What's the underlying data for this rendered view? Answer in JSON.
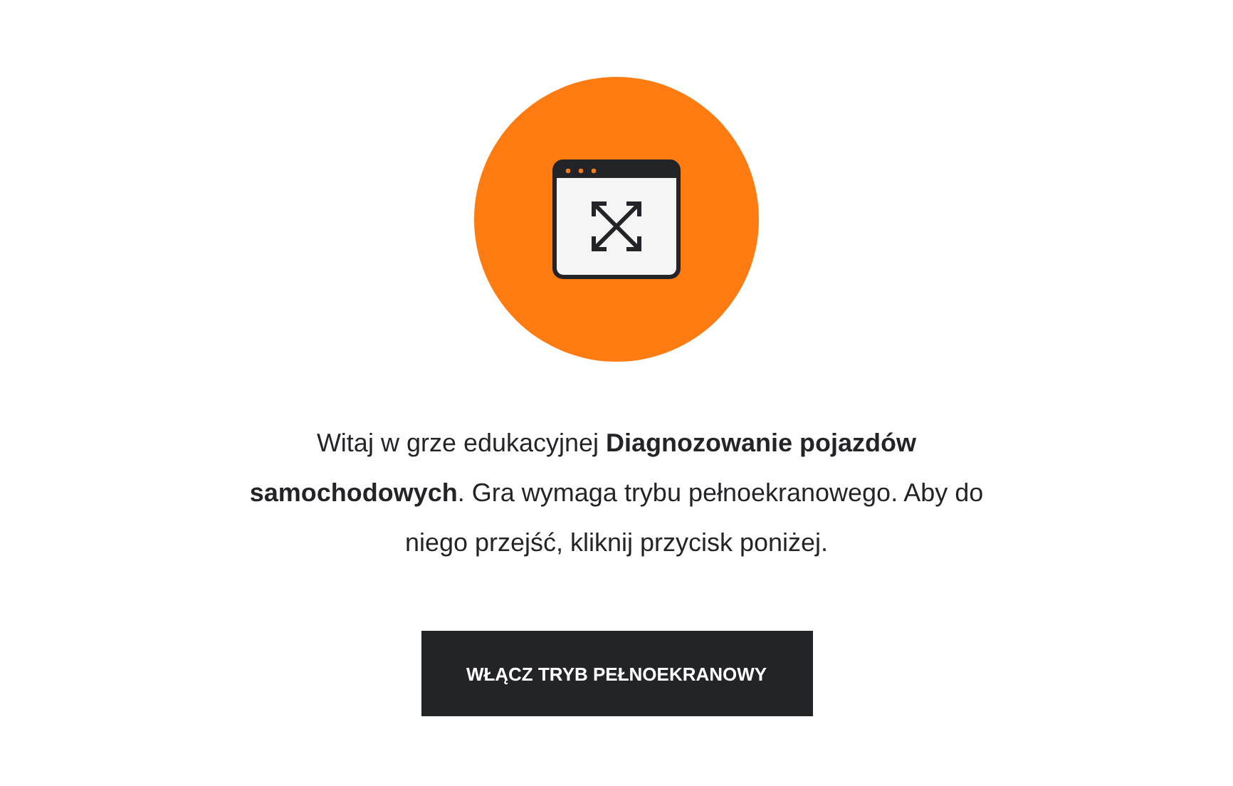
{
  "message": "Witaj w grze edukacyjnej **Diagnozowanie pojazdów samochodowych**. Gra wymaga trybu pełnoekranowego. Aby do niego przejść, kliknij przycisk poniżej.",
  "button": {
    "label": "WŁĄCZ TRYB PEŁNOEKRANOWY"
  }
}
